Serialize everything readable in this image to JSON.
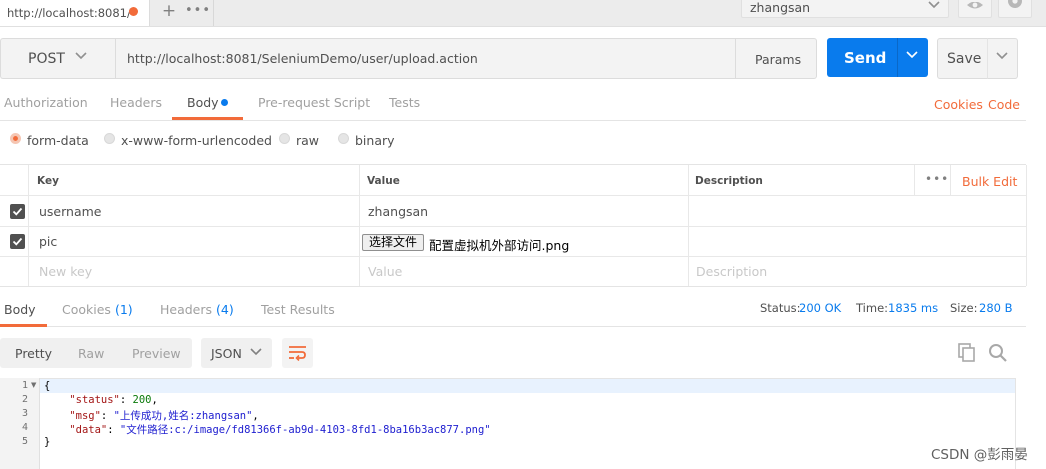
{
  "tabbar": {
    "active_tab_title": "http://localhost:8081/",
    "plus": "+",
    "more": "•••"
  },
  "environment": {
    "selected": "zhangsan"
  },
  "request": {
    "method": "POST",
    "url": "http://localhost:8081/SeleniumDemo/user/upload.action",
    "params_label": "Params",
    "send_label": "Send",
    "save_label": "Save"
  },
  "request_tabs": {
    "authorization": "Authorization",
    "headers": "Headers",
    "body": "Body",
    "prerequest": "Pre-request Script",
    "tests": "Tests",
    "cookies": "Cookies",
    "code": "Code"
  },
  "body_modes": {
    "form_data": "form-data",
    "urlencoded": "x-www-form-urlencoded",
    "raw": "raw",
    "binary": "binary",
    "selected": "form-data"
  },
  "form_table": {
    "headers": {
      "key": "Key",
      "value": "Value",
      "description": "Description"
    },
    "more": "•••",
    "bulk_edit": "Bulk Edit",
    "rows": [
      {
        "checked": true,
        "key": "username",
        "value": "zhangsan"
      },
      {
        "checked": true,
        "key": "pic",
        "file_button": "选择文件",
        "value": "配置虚拟机外部访问.png"
      }
    ],
    "placeholder": {
      "key": "New key",
      "value": "Value",
      "description": "Description"
    }
  },
  "response_tabs": {
    "body": "Body",
    "cookies": "Cookies",
    "cookies_count": "(1)",
    "headers": "Headers",
    "headers_count": "(4)",
    "test_results": "Test Results"
  },
  "response_meta": {
    "status_label": "Status:",
    "status_value": "200 OK",
    "time_label": "Time:",
    "time_value": "1835 ms",
    "size_label": "Size:",
    "size_value": "280 B"
  },
  "response_view": {
    "formats": [
      "Pretty",
      "Raw",
      "Preview"
    ],
    "active_format": "Pretty",
    "language": "JSON"
  },
  "response_body": {
    "line_numbers": [
      "1",
      "2",
      "3",
      "4",
      "5"
    ],
    "status_key": "\"status\"",
    "status_value": "200",
    "msg_key": "\"msg\"",
    "msg_value": "\"上传成功,姓名:zhangsan\"",
    "data_key": "\"data\"",
    "data_value": "\"文件路径:c:/image/fd81366f-ab9d-4103-8fd1-8ba16b3ac877.png\""
  },
  "watermark": "CSDN @彭雨晏",
  "icons": [
    "eye-icon",
    "gear-icon",
    "chevron-down-icon",
    "checkbox-checked-icon",
    "wrap-lines-icon",
    "copy-icon",
    "search-icon"
  ],
  "colors": {
    "accent_orange": "#f26b3a",
    "send_blue": "#097bed",
    "link_blue": "#097bed"
  }
}
